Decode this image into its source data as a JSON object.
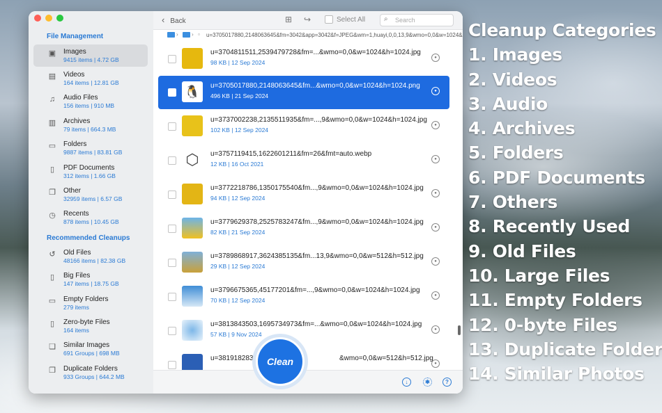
{
  "sidebar": {
    "section_file_management": "File Management",
    "section_recommended": "Recommended Cleanups",
    "file_items": [
      {
        "name": "Images",
        "sub": "9415 items | 4.72 GB",
        "icon": "images-icon"
      },
      {
        "name": "Videos",
        "sub": "164 items | 12.81 GB",
        "icon": "film-icon"
      },
      {
        "name": "Audio Files",
        "sub": "156 items | 910 MB",
        "icon": "music-note-icon"
      },
      {
        "name": "Archives",
        "sub": "79 items | 664.3 MB",
        "icon": "archive-icon"
      },
      {
        "name": "Folders",
        "sub": "9887 items | 83.81 GB",
        "icon": "folder-icon"
      },
      {
        "name": "PDF Documents",
        "sub": "312 items | 1.66 GB",
        "icon": "document-icon"
      },
      {
        "name": "Other",
        "sub": "32959 items | 6.57 GB",
        "icon": "other-files-icon"
      },
      {
        "name": "Recents",
        "sub": "878 items | 10.45 GB",
        "icon": "clock-icon"
      }
    ],
    "recommended_items": [
      {
        "name": "Old Files",
        "sub": "48166 items | 82.38 GB",
        "icon": "history-icon"
      },
      {
        "name": "Big Files",
        "sub": "147 items | 18.75 GB",
        "icon": "big-file-icon"
      },
      {
        "name": "Empty Folders",
        "sub": "279 items",
        "icon": "empty-folder-icon"
      },
      {
        "name": "Zero-byte Files",
        "sub": "164 items",
        "icon": "zero-file-icon"
      },
      {
        "name": "Similar Images",
        "sub": "691 Groups | 698 MB",
        "icon": "similar-images-icon"
      },
      {
        "name": "Duplicate Folders",
        "sub": "933 Groups | 644.2 MB",
        "icon": "duplicate-folder-icon"
      }
    ]
  },
  "toolbar": {
    "back_label": "Back",
    "select_all_label": "Select All",
    "search_placeholder": "Search"
  },
  "pathbar": {
    "path_text": "u=3705017880,2148063645&fm=3042&app=3042&f=JPEG&wm=1,huayi,0,0,13,9&wmo=0,0&w=1024&h=1024.png"
  },
  "files": [
    {
      "name": "u=3704811511,2539479728&fm=...&wmo=0,0&w=1024&h=1024.jpg",
      "meta": "98 KB | 12 Sep 2024",
      "selected": false,
      "thumb": "#e6b80e"
    },
    {
      "name": "u=3705017880,2148063645&fm...&wmo=0,0&w=1024&h=1024.png",
      "meta": "496 KB | 21 Sep 2024",
      "selected": true,
      "thumb": "#ffffff"
    },
    {
      "name": "u=3737002238,2135511935&fm=...,9&wmo=0,0&w=1024&h=1024.jpg",
      "meta": "102 KB | 12 Sep 2024",
      "selected": false,
      "thumb": "#e8c21a"
    },
    {
      "name": "u=3757119415,1622601211&fm=26&fmt=auto.webp",
      "meta": "12 KB | 16 Oct 2021",
      "selected": false,
      "thumb": "#ffffff"
    },
    {
      "name": "u=3772218786,1350175540&fm...,9&wmo=0,0&w=1024&h=1024.jpg",
      "meta": "94 KB | 12 Sep 2024",
      "selected": false,
      "thumb": "#e3b515"
    },
    {
      "name": "u=3779629378,2525783247&fm...,9&wmo=0,0&w=1024&h=1024.jpg",
      "meta": "82 KB | 21 Sep 2024",
      "selected": false,
      "thumb": "#5aa6e0"
    },
    {
      "name": "u=3789868917,3624385135&fm...13,9&wmo=0,0&w=512&h=512.jpg",
      "meta": "29 KB | 12 Sep 2024",
      "selected": false,
      "thumb": "#c9a13a"
    },
    {
      "name": "u=3796675365,45177201&fm=...,9&wmo=0,0&w=1024&h=1024.jpg",
      "meta": "70 KB | 12 Sep 2024",
      "selected": false,
      "thumb": "#3f8ed6"
    },
    {
      "name": "u=3813843503,1695734973&fm=...&wmo=0,0&w=1024&h=1024.jpg",
      "meta": "57 KB | 9 Nov 2024",
      "selected": false,
      "thumb": "#7db7e8"
    },
    {
      "name": "u=3819182836,2338",
      "name_tail": "&wmo=0,0&w=512&h=512.jpg",
      "meta": "",
      "selected": false,
      "thumb": "#2b5fb5"
    }
  ],
  "clean_button": "Clean",
  "promo": {
    "title": "Cleanup Categories",
    "items": [
      "1. Images",
      "2. Videos",
      "3. Audio",
      "4. Archives",
      "5. Folders",
      "6. PDF Documents",
      "7. Others",
      "8. Recently Used",
      "9. Old Files",
      "10. Large Files",
      "11. Empty Folders",
      "12. 0-byte Files",
      "13. Duplicate Folders",
      "14. Similar Photos"
    ]
  },
  "colors": {
    "accent": "#1e6be0",
    "link": "#2a7ad4",
    "sidebar_bg": "#eceef0"
  }
}
